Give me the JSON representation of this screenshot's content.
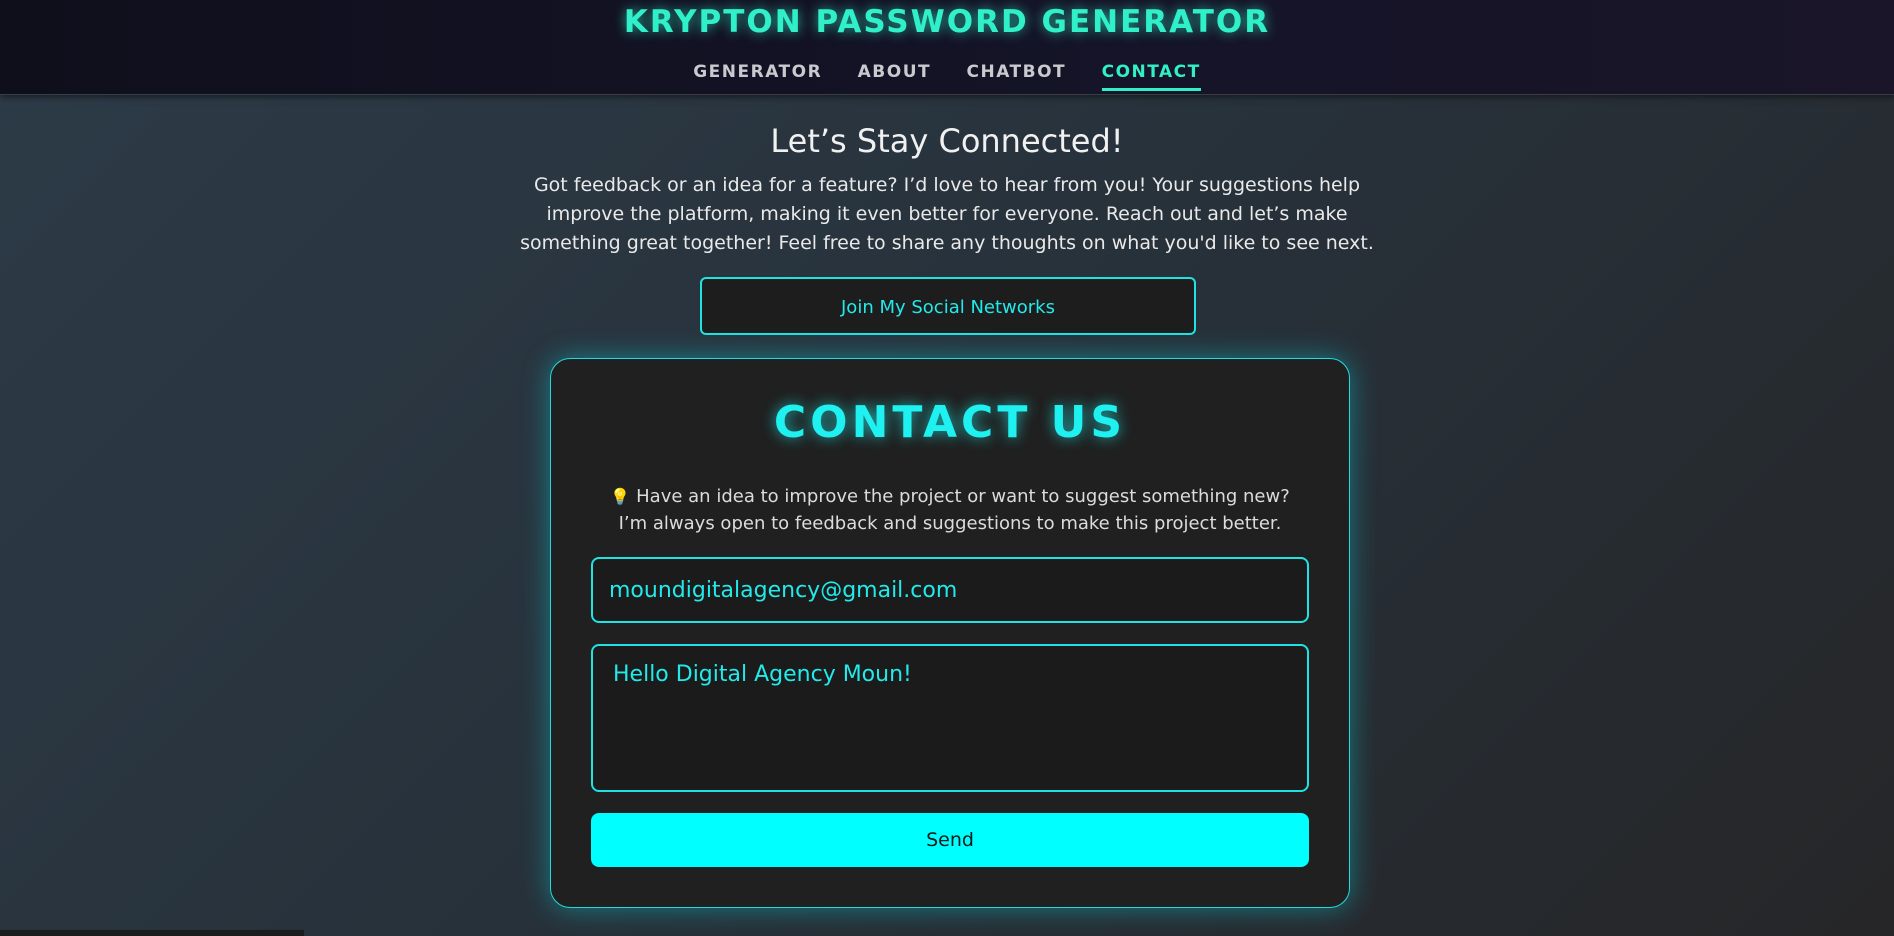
{
  "header": {
    "brand": "KRYPTON PASSWORD GENERATOR",
    "nav": [
      {
        "label": "GENERATOR",
        "active": false
      },
      {
        "label": "ABOUT",
        "active": false
      },
      {
        "label": "CHATBOT",
        "active": false
      },
      {
        "label": "CONTACT",
        "active": true
      }
    ],
    "accent_color": "#2ff0c8"
  },
  "intro": {
    "title": "Let’s Stay Connected!",
    "text": "Got feedback or an idea for a feature? I’d love to hear from you! Your suggestions help improve the platform, making it even better for everyone. Reach out and let’s make something great together! Feel free to share any thoughts on what you'd like to see next.",
    "social_button": "Join My Social Networks"
  },
  "contact": {
    "title": "CONTACT US",
    "bulb_icon": "lightbulb-icon",
    "line1": "Have an idea to improve the project or want to suggest something new?",
    "line2": "I’m always open to feedback and suggestions to make this project better.",
    "email_value": "moundigitalagency@gmail.com",
    "message_value": "Hello Digital Agency Moun!",
    "send_label": "Send",
    "accent_color": "#00ffff"
  }
}
